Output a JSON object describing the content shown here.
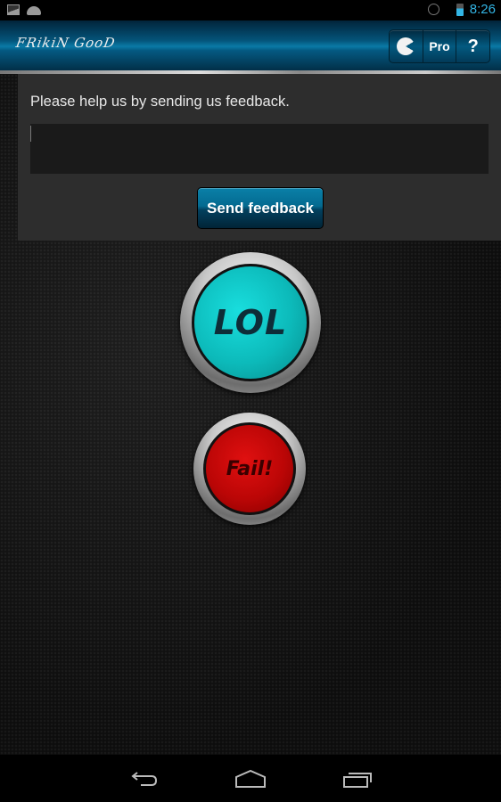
{
  "status_bar": {
    "icons": [
      "gallery-icon",
      "android-icon",
      "alarm-icon",
      "battery-charging-icon"
    ],
    "time": "8:26"
  },
  "action_bar": {
    "app_title": "FRikiN GooD",
    "buttons": [
      {
        "name": "pacman-icon",
        "label": ""
      },
      {
        "name": "pro",
        "label": "Pro"
      },
      {
        "name": "help",
        "label": "?"
      }
    ]
  },
  "feedback": {
    "prompt": "Please help us by sending us feedback.",
    "input_value": "",
    "input_placeholder": "",
    "send_label": "Send feedback"
  },
  "sound_buttons": {
    "lol": {
      "label": "LOL",
      "color": "#0cbaba"
    },
    "fail": {
      "label": "Fail!",
      "color": "#bb0606"
    }
  },
  "nav_bar": {
    "buttons": [
      "back",
      "home",
      "recent-apps"
    ]
  },
  "colors": {
    "accent": "#33b5e5",
    "action_bar": "#04547a"
  }
}
